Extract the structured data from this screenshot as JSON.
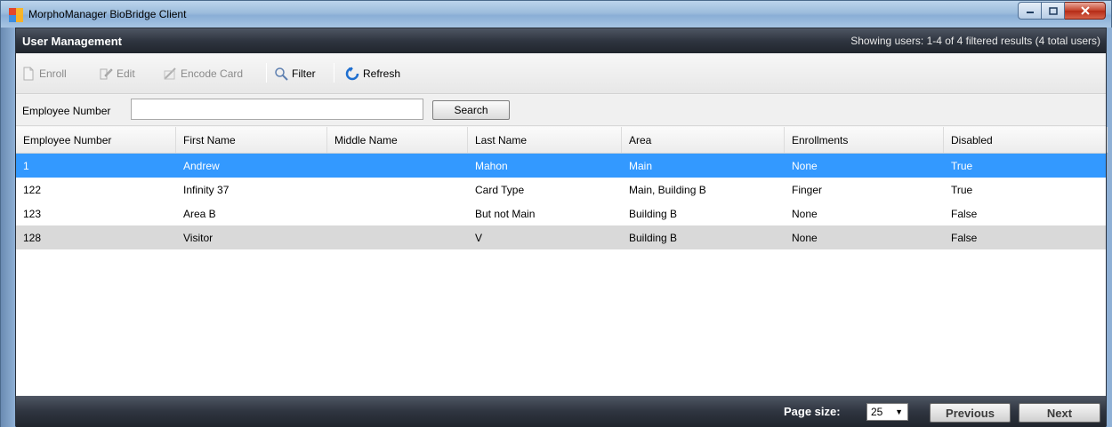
{
  "window": {
    "title": "MorphoManager BioBridge Client",
    "controls": {
      "minimize_icon": "minimize-icon",
      "maximize_icon": "maximize-icon",
      "close_icon": "close-icon"
    }
  },
  "header": {
    "title": "User Management",
    "status": "Showing users: 1-4 of 4 filtered results (4 total users)"
  },
  "toolbar": {
    "enroll": "Enroll",
    "edit": "Edit",
    "encode_card": "Encode Card",
    "filter": "Filter",
    "refresh": "Refresh"
  },
  "search": {
    "label": "Employee Number",
    "value": "",
    "button": "Search"
  },
  "table": {
    "columns": [
      "Employee Number",
      "First Name",
      "Middle Name",
      "Last Name",
      "Area",
      "Enrollments",
      "Disabled"
    ],
    "rows": [
      [
        "1",
        "Andrew",
        "",
        "Mahon",
        "Main",
        "None",
        "True"
      ],
      [
        "122",
        "Infinity 37",
        "",
        "Card Type",
        "Main, Building B",
        "Finger",
        "True"
      ],
      [
        "123",
        "Area B",
        "",
        "But not Main",
        "Building B",
        "None",
        "False"
      ],
      [
        "128",
        "Visitor",
        "",
        "V",
        "Building B",
        "None",
        "False"
      ]
    ],
    "selected_row": 0
  },
  "footer": {
    "page_size_label": "Page size:",
    "page_size_value": "25",
    "previous": "Previous",
    "next": "Next"
  },
  "colors": {
    "selection": "#3399ff",
    "header_dark": "#2f3540",
    "alt_row": "#d9d9d9"
  }
}
